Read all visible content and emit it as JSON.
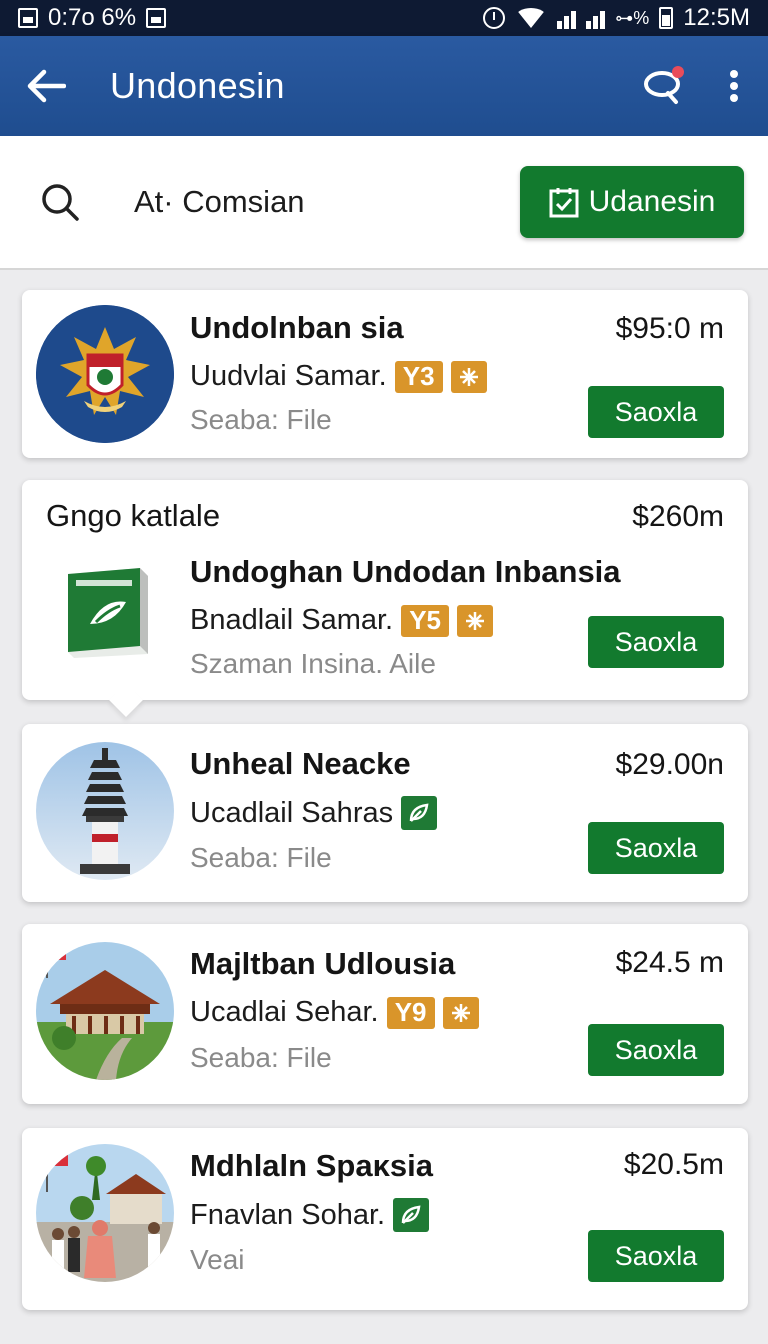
{
  "status_bar": {
    "left": "0:7o 6%",
    "right": "12:5M",
    "signal": "⊶%"
  },
  "app_bar": {
    "title": "Undonesin"
  },
  "search": {
    "query": "At· Comsian",
    "button_label": "Udanesin"
  },
  "listings": [
    {
      "title": "Undolnban sia",
      "subtitle": "Uudvlai Samar.",
      "badge": "Y3",
      "meta": "Seaba: File",
      "price": "$95:0 m",
      "button": "Saoxla",
      "image": "emblem-thumb"
    },
    {
      "header": "Gngo katlale",
      "title": "Undoghan Undodan Inbansia",
      "subtitle": "Bnadlail Samar.",
      "badge": "Y5",
      "meta": "Szaman Insina. Aile",
      "price": "$260m",
      "button": "Saoxla",
      "image": "product-box-thumb"
    },
    {
      "title": "Unheal Neacke",
      "subtitle": "Ucadlail Sahras",
      "meta": "Seaba: File",
      "price": "$29.00n",
      "button": "Saoxla",
      "image": "tower-thumb"
    },
    {
      "title": "Majltban Udlousia",
      "subtitle": "Ucadlai Sehar.",
      "badge": "Y9",
      "meta": "Seaba: File",
      "price": "$24.5 m",
      "button": "Saoxla",
      "image": "pavilion-thumb"
    },
    {
      "title": "Mdhlaln Spaᴋsia",
      "subtitle": "Fnavlan Sohar.",
      "meta": "Veai",
      "price": "$20.5m",
      "button": "Saoxla",
      "image": "people-thumb"
    }
  ],
  "colors": {
    "app_bar": "#2a5aa1",
    "accent_green": "#127a2e",
    "badge_orange": "#d9952a"
  }
}
